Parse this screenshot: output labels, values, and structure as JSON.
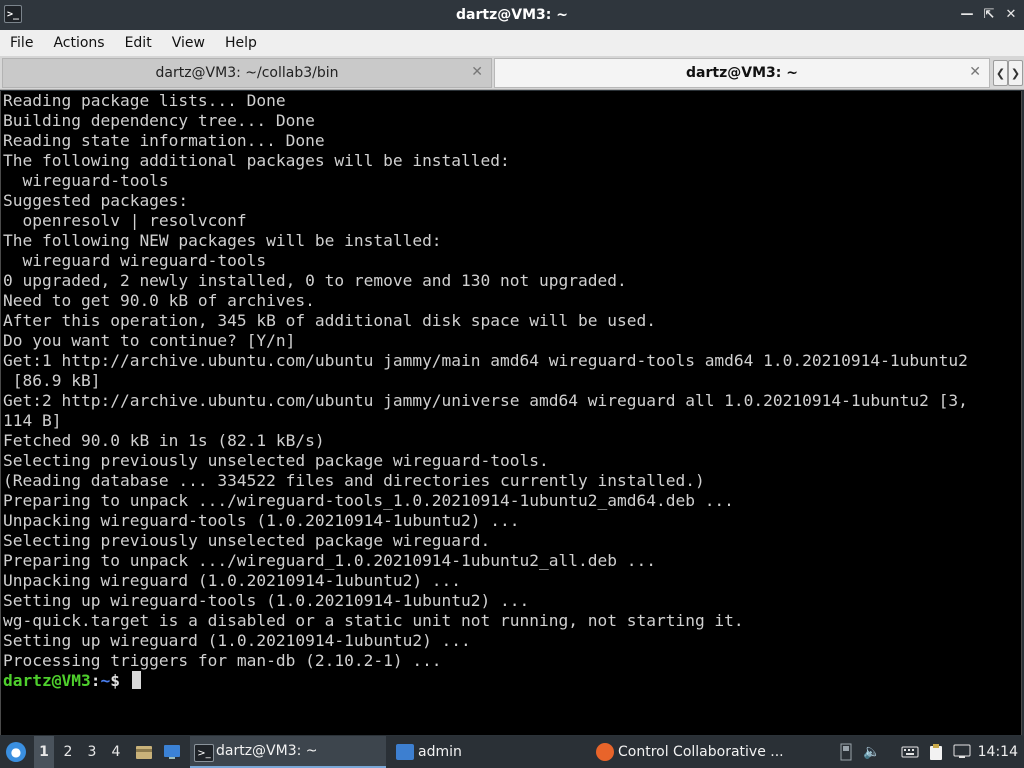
{
  "window": {
    "title": "dartz@VM3: ~",
    "app_icon": "terminal-icon",
    "controls": [
      "minimize-icon",
      "maximize-icon",
      "close-icon"
    ]
  },
  "menu": {
    "file": "File",
    "actions": "Actions",
    "edit": "Edit",
    "view": "View",
    "help": "Help"
  },
  "tabs": [
    {
      "label": "dartz@VM3: ~/collab3/bin",
      "active": false
    },
    {
      "label": "dartz@VM3: ~",
      "active": true
    }
  ],
  "terminal": {
    "lines": [
      "Reading package lists... Done",
      "Building dependency tree... Done",
      "Reading state information... Done",
      "The following additional packages will be installed:",
      "  wireguard-tools",
      "Suggested packages:",
      "  openresolv | resolvconf",
      "The following NEW packages will be installed:",
      "  wireguard wireguard-tools",
      "0 upgraded, 2 newly installed, 0 to remove and 130 not upgraded.",
      "Need to get 90.0 kB of archives.",
      "After this operation, 345 kB of additional disk space will be used.",
      "Do you want to continue? [Y/n]",
      "Get:1 http://archive.ubuntu.com/ubuntu jammy/main amd64 wireguard-tools amd64 1.0.20210914-1ubuntu2",
      " [86.9 kB]",
      "Get:2 http://archive.ubuntu.com/ubuntu jammy/universe amd64 wireguard all 1.0.20210914-1ubuntu2 [3,",
      "114 B]",
      "Fetched 90.0 kB in 1s (82.1 kB/s)",
      "Selecting previously unselected package wireguard-tools.",
      "(Reading database ... 334522 files and directories currently installed.)",
      "Preparing to unpack .../wireguard-tools_1.0.20210914-1ubuntu2_amd64.deb ...",
      "Unpacking wireguard-tools (1.0.20210914-1ubuntu2) ...",
      "Selecting previously unselected package wireguard.",
      "Preparing to unpack .../wireguard_1.0.20210914-1ubuntu2_all.deb ...",
      "Unpacking wireguard (1.0.20210914-1ubuntu2) ...",
      "Setting up wireguard-tools (1.0.20210914-1ubuntu2) ...",
      "wg-quick.target is a disabled or a static unit not running, not starting it.",
      "Setting up wireguard (1.0.20210914-1ubuntu2) ...",
      "Processing triggers for man-db (2.10.2-1) ..."
    ],
    "prompt_user": "dartz@VM3",
    "prompt_sep": ":",
    "prompt_path": "~",
    "prompt_symbol": "$ "
  },
  "taskbar": {
    "start_icon": "start-menu-icon",
    "workspaces": [
      "1",
      "2",
      "3",
      "4"
    ],
    "current_workspace": "1",
    "launchers": [
      "file-manager-icon",
      "show-desktop-icon"
    ],
    "tasks": [
      {
        "label": "dartz@VM3: ~",
        "icon": "terminal-icon",
        "active": true
      },
      {
        "label": "admin",
        "icon": "folder-icon",
        "active": false
      },
      {
        "label": "Control Collaborative ...",
        "icon": "firefox-icon",
        "active": false
      }
    ],
    "tray": [
      "scroll-indicator-icon",
      "volume-icon",
      "keyboard-icon",
      "clipboard-icon",
      "network-icon"
    ],
    "clock": "14:14"
  },
  "colors": {
    "terminal_bg": "#000000",
    "terminal_fg": "#d0d0d0",
    "prompt_user": "#4ecf2c",
    "prompt_path": "#4a7ff0",
    "titlebar_bg": "#2f363d",
    "taskbar_bg": "#2a3036"
  }
}
